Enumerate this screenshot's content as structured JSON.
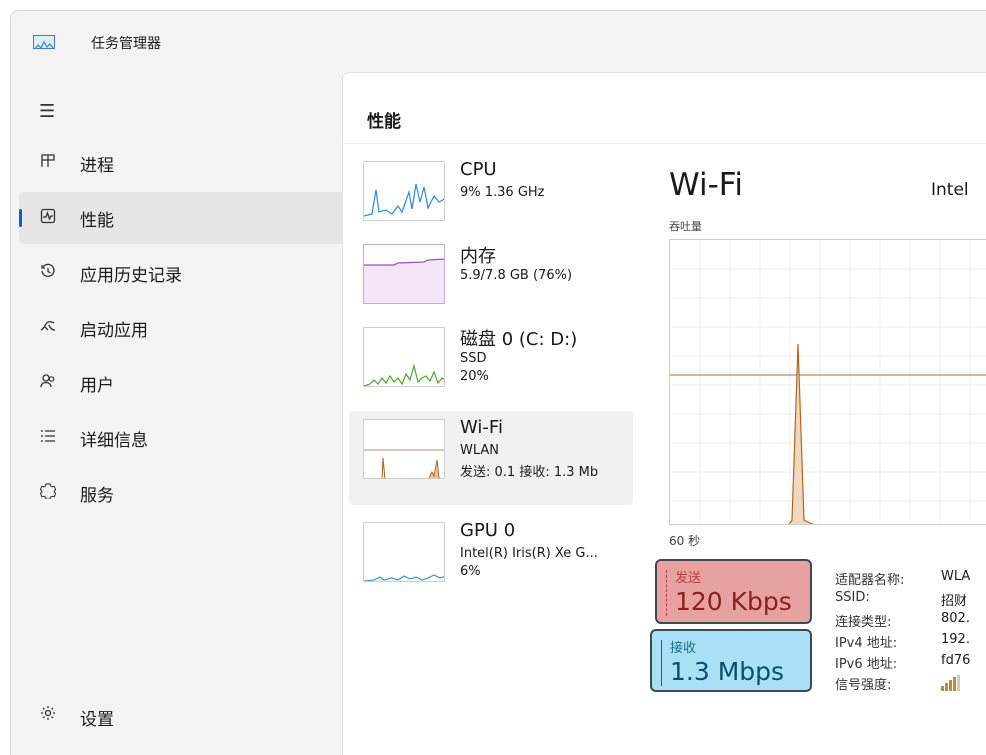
{
  "window": {
    "title": "任务管理器",
    "app_icon": "chart-icon"
  },
  "sidebar": {
    "menu_icon": "hamburger-icon",
    "items": [
      {
        "label": "进程",
        "icon": "processes-icon",
        "active": false
      },
      {
        "label": "性能",
        "icon": "performance-icon",
        "active": true
      },
      {
        "label": "应用历史记录",
        "icon": "history-icon",
        "active": false
      },
      {
        "label": "启动应用",
        "icon": "startup-icon",
        "active": false
      },
      {
        "label": "用户",
        "icon": "users-icon",
        "active": false
      },
      {
        "label": "详细信息",
        "icon": "details-icon",
        "active": false
      },
      {
        "label": "服务",
        "icon": "services-icon",
        "active": false
      }
    ],
    "settings": {
      "label": "设置",
      "icon": "gear-icon"
    }
  },
  "main": {
    "title": "性能",
    "devices": [
      {
        "name": "CPU",
        "line1": "9% 1.36 GHz",
        "line2": "",
        "line3": "",
        "color": "#2a8fd4"
      },
      {
        "name": "内存",
        "line1": "5.9/7.8 GB (76%)",
        "line2": "",
        "line3": "",
        "color": "#9b4fbf"
      },
      {
        "name": "磁盘 0 (C: D:)",
        "line1": "SSD",
        "line2": "20%",
        "line3": "",
        "color": "#4ea72e"
      },
      {
        "name": "Wi-Fi",
        "line1": "WLAN",
        "line2": "发送: 0.1 接收: 1.3 Mb",
        "line3": "",
        "color": "#b5651d"
      },
      {
        "name": "GPU 0",
        "line1": "Intel(R) Iris(R) Xe G...",
        "line2": "6%",
        "line3": "",
        "color": "#2a8fd4"
      }
    ],
    "detail": {
      "title": "Wi-Fi",
      "adapter": "Intel",
      "graph_label": "吞吐量",
      "time_label": "60 秒",
      "send": {
        "label": "发送",
        "value": "120 Kbps",
        "color": "#e8a1a1"
      },
      "receive": {
        "label": "接收",
        "value": "1.3 Mbps",
        "color": "#a9e0f6"
      },
      "properties": [
        {
          "key": "适配器名称:",
          "value": "WLA"
        },
        {
          "key": "SSID:",
          "value": "招财"
        },
        {
          "key": "连接类型:",
          "value": "802."
        },
        {
          "key": "IPv4 地址:",
          "value": "192."
        },
        {
          "key": "IPv6 地址:",
          "value": "fd76"
        },
        {
          "key": "信号强度:",
          "value": ""
        }
      ],
      "signal_level_bars": 4
    }
  }
}
